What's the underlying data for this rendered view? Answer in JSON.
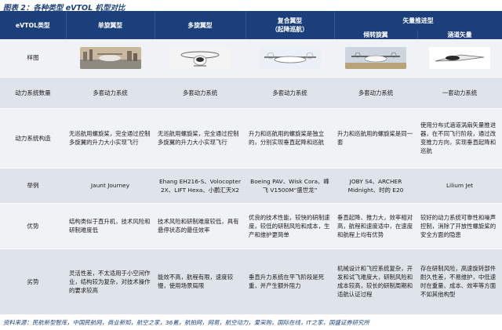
{
  "title": "图表 2：各种类型 eVTOL 机型对比",
  "headers": {
    "col0": "eVTOL类型",
    "col1": "单旋翼型",
    "col2": "多旋翼型",
    "col3a": "复合翼型",
    "col3b": "（起降巡航）",
    "col4": "矢量推进型",
    "col4a": "倾转旋翼",
    "col4b": "涵道矢量"
  },
  "row_labels": {
    "image": "样图",
    "count": "动力系统数量",
    "structure": "动力系统构造",
    "examples": "举例",
    "pros": "优势",
    "cons": "劣势"
  },
  "images": {
    "c1": "ehang-single-rotor-cityscape",
    "c2": "multicopter-aircraft",
    "c3": "compound-wing-aircraft",
    "c4": "tilt-rotor-aircraft",
    "c5": "ducted-vector-jet"
  },
  "count": {
    "c1": "多套动力系统",
    "c2": "多套动力系统",
    "c3": "多套动力系统",
    "c4": "多套动力系统",
    "c5": "一套动力系统"
  },
  "structure": {
    "c1": "无巡航用螺旋桨，完全通过控制多旋翼的升力大小实现飞行",
    "c2": "无巡航用螺旋桨，完全通过控制多旋翼的升力大小实现飞行",
    "c3": "升力和巡航用的螺旋桨是独立的，分别实现垂直起降和巡航",
    "c4": "升力和巡航用的螺旋桨是同一套",
    "c5": "使用分布式涵道涡扇矢量推进器，在不同飞行阶段，通过改变推力方向，实现垂直起降和巡航"
  },
  "examples": {
    "c1": "Jaunt Journey",
    "c2": "Ehang EH216-S、Volocopter 2X、LIFT Hexa、小鹏汇天X2",
    "c3": "Boeing PAV、Wisk Cora、峰飞 V1500M“盛世龙”",
    "c4": "JOBY S4、ARCHER Midnight、时的 E20",
    "c5": "Lilium Jet"
  },
  "pros": {
    "c1": "结构类似于直升机，技术风险和研制难度低",
    "c2": "技术风险和研制难度较低，具有悬停状态的最佳效率",
    "c3": "优良的技术性能，较快的研制速度，较低的研制风险和成本，生产和维护更简单",
    "c4": "垂直起降、推力大，效率相对高，航程和速度适中，在速度和航程上均有优势",
    "c5": "较好的动力系统可靠性和噪声控制，消除了开放性螺旋桨的安全方面的隐患"
  },
  "cons": {
    "c1": "灵活性差，不太适用于小空间作业，结构较为复杂，对技术操作的要求较高",
    "c2": "能效不高，航程有限，速度较慢，使用场景局限",
    "c3": "垂直升力系统在平飞阶段是死重，并产生额外阻力",
    "c4": "机械设计和飞控系统复杂，开发和试飞难度大，研制风险和成本较高，较长的研制周期和适航认证过程",
    "c5": "存在研制风险，高速旋转部件耐久性差，不易维护，中低速时在重量、成本、效率等方面不如其他构型"
  },
  "source": "资料来源：民航新型智库，中国民航网，商业新知，航空之家，36氪，航拍网，网易，航空动力，爱采购，国际在线，IT之家，国盛证券研究所",
  "watermark": "国盛证券研究"
}
